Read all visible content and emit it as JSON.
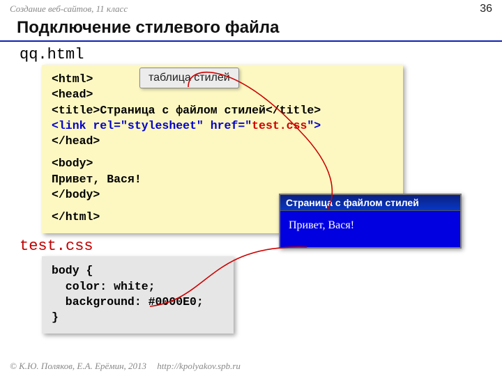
{
  "header": {
    "subject": "Создание веб-сайтов, 11 класс",
    "page_number": "36"
  },
  "title": "Подключение стилевого файла",
  "file1": {
    "name": "qq.html",
    "callout": "таблица стилей",
    "lines": {
      "l1": "<html>",
      "l2": "<head>",
      "l3a": "<title>",
      "l3b": "Страница с файлом стилей",
      "l3c": "</title>",
      "l4a": "<link rel=\"stylesheet\" href=\"",
      "l4b": "test.css",
      "l4c": "\">",
      "l5": "</head>",
      "l6": "<body>",
      "l7": "Привет, Вася!",
      "l8": "</body>",
      "l9": "</html>"
    }
  },
  "file2": {
    "name": "test.css",
    "lines": {
      "l1": "body {",
      "l2": "  color: white;",
      "l3": "  background: #0000E0;",
      "l4": "}"
    }
  },
  "browser": {
    "title": "Страница с файлом стилей",
    "body": "Привет, Вася!"
  },
  "footer": {
    "copyright": "© К.Ю. Поляков, Е.А. Ерёмин, 2013",
    "url": "http://kpolyakov.spb.ru"
  }
}
